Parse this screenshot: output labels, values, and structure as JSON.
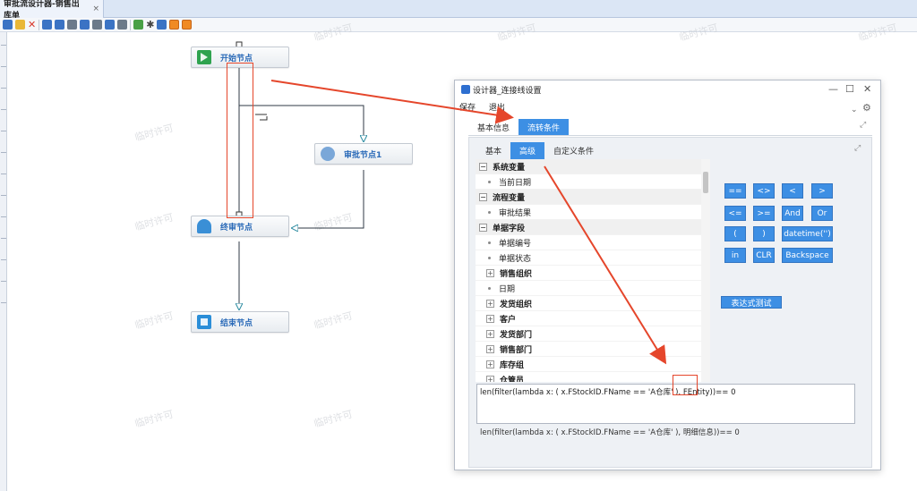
{
  "tab": {
    "title": "审批流设计器-销售出库单",
    "close": "×"
  },
  "toolbar": {
    "icons": [
      "new-icon",
      "copy-icon",
      "delete-icon",
      "align-left-icon",
      "align-center-icon",
      "align-right-icon",
      "align-top-icon",
      "align-middle-icon",
      "align-bottom-icon",
      "validate-icon",
      "settings-icon",
      "window-icon",
      "flow-icon",
      "note-icon"
    ]
  },
  "nodes": {
    "start": "开始节点",
    "approve1": "审批节点1",
    "final": "终审节点",
    "end": "结束节点"
  },
  "watermark": "临时许可",
  "dialog": {
    "title": "设计器_连接线设置",
    "menu": {
      "save": "保存",
      "exit": "退出"
    },
    "tabs": [
      "基本信息",
      "流转条件"
    ],
    "active_tab": 1,
    "subtabs": [
      "基本",
      "高级",
      "自定义条件"
    ],
    "active_subtab": 1,
    "tree": [
      {
        "label": "系统变量",
        "type": "group"
      },
      {
        "label": "当前日期",
        "type": "leaf"
      },
      {
        "label": "流程变量",
        "type": "group"
      },
      {
        "label": "审批结果",
        "type": "leaf"
      },
      {
        "label": "单据字段",
        "type": "group"
      },
      {
        "label": "单据编号",
        "type": "leaf"
      },
      {
        "label": "单据状态",
        "type": "leaf"
      },
      {
        "label": "销售组织",
        "type": "sub"
      },
      {
        "label": "日期",
        "type": "leaf"
      },
      {
        "label": "发货组织",
        "type": "sub"
      },
      {
        "label": "客户",
        "type": "sub"
      },
      {
        "label": "发货部门",
        "type": "sub"
      },
      {
        "label": "销售部门",
        "type": "sub"
      },
      {
        "label": "库存组",
        "type": "sub"
      },
      {
        "label": "仓管员",
        "type": "sub"
      }
    ],
    "operators": {
      "eq": "==",
      "ne": "<>",
      "lt": "<",
      "gt": ">",
      "le": "<=",
      "ge": ">=",
      "and": "And",
      "or": "Or",
      "lparen": "(",
      "rparen": ")",
      "datetime": "datetime('')",
      "in": "in",
      "clr": "CLR",
      "backspace": "Backspace"
    },
    "test_button": "表达式测试",
    "expression": "len(filter(lambda x: ( x.FStockID.FName == 'A仓库' ), FEntity))== 0",
    "preview": "len(filter(lambda x: ( x.FStockID.FName == 'A仓库' ), 明细信息))== 0"
  },
  "colors": {
    "accent": "#3d8fe4",
    "annotation": "#e5462b",
    "node_text": "#2a6ab8"
  }
}
